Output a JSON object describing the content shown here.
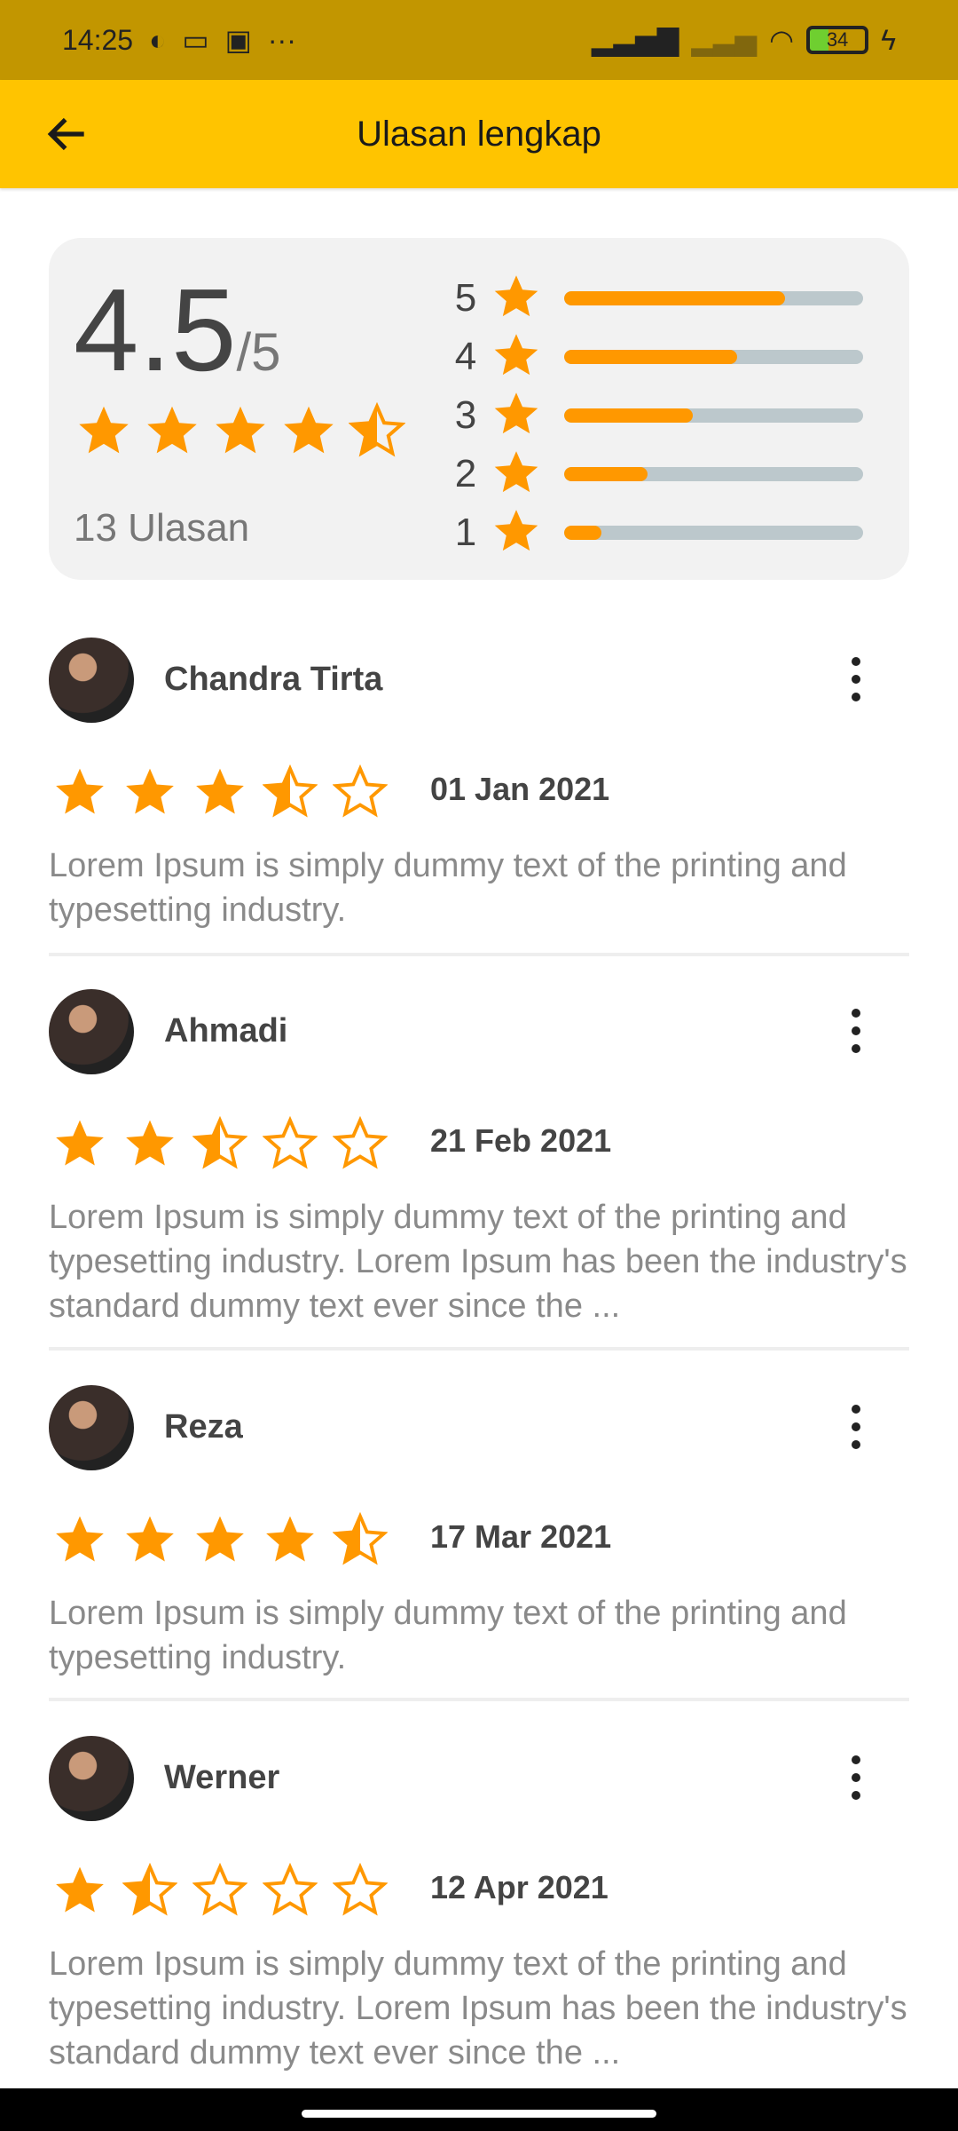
{
  "status_bar": {
    "time": "14:25",
    "battery": "34"
  },
  "header": {
    "title": "Ulasan lengkap",
    "back_icon": "arrow-left-icon"
  },
  "colors": {
    "accent": "#ff9800",
    "header": "#ffc400",
    "status": "#c29600",
    "track": "#bcc8cc"
  },
  "summary": {
    "average": "4.5",
    "max": "/5",
    "rating": 4.5,
    "count_label": "13 Ulasan",
    "distribution": [
      {
        "stars": "5",
        "fraction": 0.74
      },
      {
        "stars": "4",
        "fraction": 0.58
      },
      {
        "stars": "3",
        "fraction": 0.43
      },
      {
        "stars": "2",
        "fraction": 0.28
      },
      {
        "stars": "1",
        "fraction": 0.125
      }
    ]
  },
  "reviews": [
    {
      "name": "Chandra Tirta",
      "rating": 3.5,
      "date": "01 Jan 2021",
      "text": "Lorem Ipsum is simply dummy text of the printing and typesetting industry."
    },
    {
      "name": "Ahmadi",
      "rating": 2.5,
      "date": "21 Feb 2021",
      "text": "Lorem Ipsum is simply dummy text of the printing and typesetting industry. Lorem Ipsum has been the industry's standard dummy text ever since the ..."
    },
    {
      "name": "Reza",
      "rating": 4.5,
      "date": "17 Mar 2021",
      "text": "Lorem Ipsum is simply dummy text of the printing and typesetting industry."
    },
    {
      "name": "Werner",
      "rating": 1.5,
      "date": "12 Apr 2021",
      "text": "Lorem Ipsum is simply dummy text of the printing and typesetting industry. Lorem Ipsum has been the industry's standard dummy text ever since the ..."
    }
  ]
}
